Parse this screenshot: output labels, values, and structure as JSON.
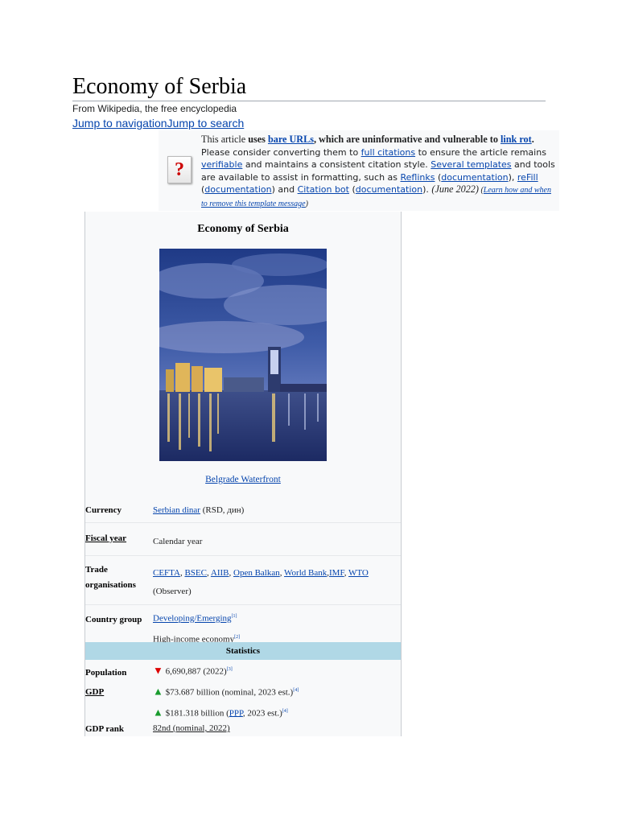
{
  "page": {
    "title": "Economy of Serbia",
    "tagline": "From Wikipedia, the free encyclopedia",
    "jump_nav": "Jump to navigation",
    "jump_search": "Jump to search"
  },
  "ambox": {
    "icon": "question-mark-icon",
    "t1": "This article ",
    "t2": "uses ",
    "t3": "bare URLs",
    "t4": ", which are uninformative and vulnerable to ",
    "t5": "link rot",
    "t6": ".",
    "t7": " Please consider converting them to ",
    "t8": "full citations",
    "t9": " to ensure the article remains ",
    "t10": "verifiable",
    "t11": " and maintains a consistent citation style. ",
    "t12": "Several templates",
    "t13": " and tools are available to assist in formatting, such as ",
    "t14": "Reflinks",
    "t15": " (",
    "t16": "documentation",
    "t17": "), ",
    "t18": "reFill",
    "t19": " (",
    "t20": "documentation",
    "t21": ") and ",
    "t22": "Citation bot",
    "t23": " (",
    "t24": "documentation",
    "t25": "). ",
    "t26": "(June 2022)",
    "t27": " (",
    "t28": "Learn how and when to remove this template message",
    "t29": ")"
  },
  "infobox": {
    "caption": "Economy of Serbia",
    "photo_caption": "Belgrade Waterfront",
    "currency_label": "Currency",
    "currency_link": "Serbian dinar",
    "currency_rest": " (RSD, дин)",
    "fiscal_label": "Fiscal year",
    "fiscal_value": "Calendar year",
    "trade_label": "Trade organisations",
    "trade_l1": "CEFTA",
    "trade_l2": "BSEC",
    "trade_l3": "AIIB",
    "trade_l4": "Open Balkan",
    "trade_l5": "World Bank",
    "trade_l6": "IMF",
    "trade_l7": "WTO",
    "trade_observer": " (Observer)",
    "country_label": "Country group",
    "country_link": "Developing/Emerging",
    "country_ref": "[1]",
    "country_v2": "High-income economy",
    "country_ref2": "[2]",
    "stats_header": "Statistics",
    "population_label": "Population",
    "population_value": "6,690,887 (2022)",
    "population_ref": "[3]",
    "gdp_label": "GDP",
    "gdp_nominal": "$73.687 billion (nominal, 2023 est.)",
    "gdp_nominal_ref": "[4]",
    "gdp_ppp_pre": "$181.318 billion (",
    "gdp_ppp_link": "PPP",
    "gdp_ppp_post": ", 2023 est.)",
    "gdp_ppp_ref": "[4]",
    "gdprank_label": "GDP rank",
    "gdprank_value": "82nd (nominal, 2022)"
  }
}
